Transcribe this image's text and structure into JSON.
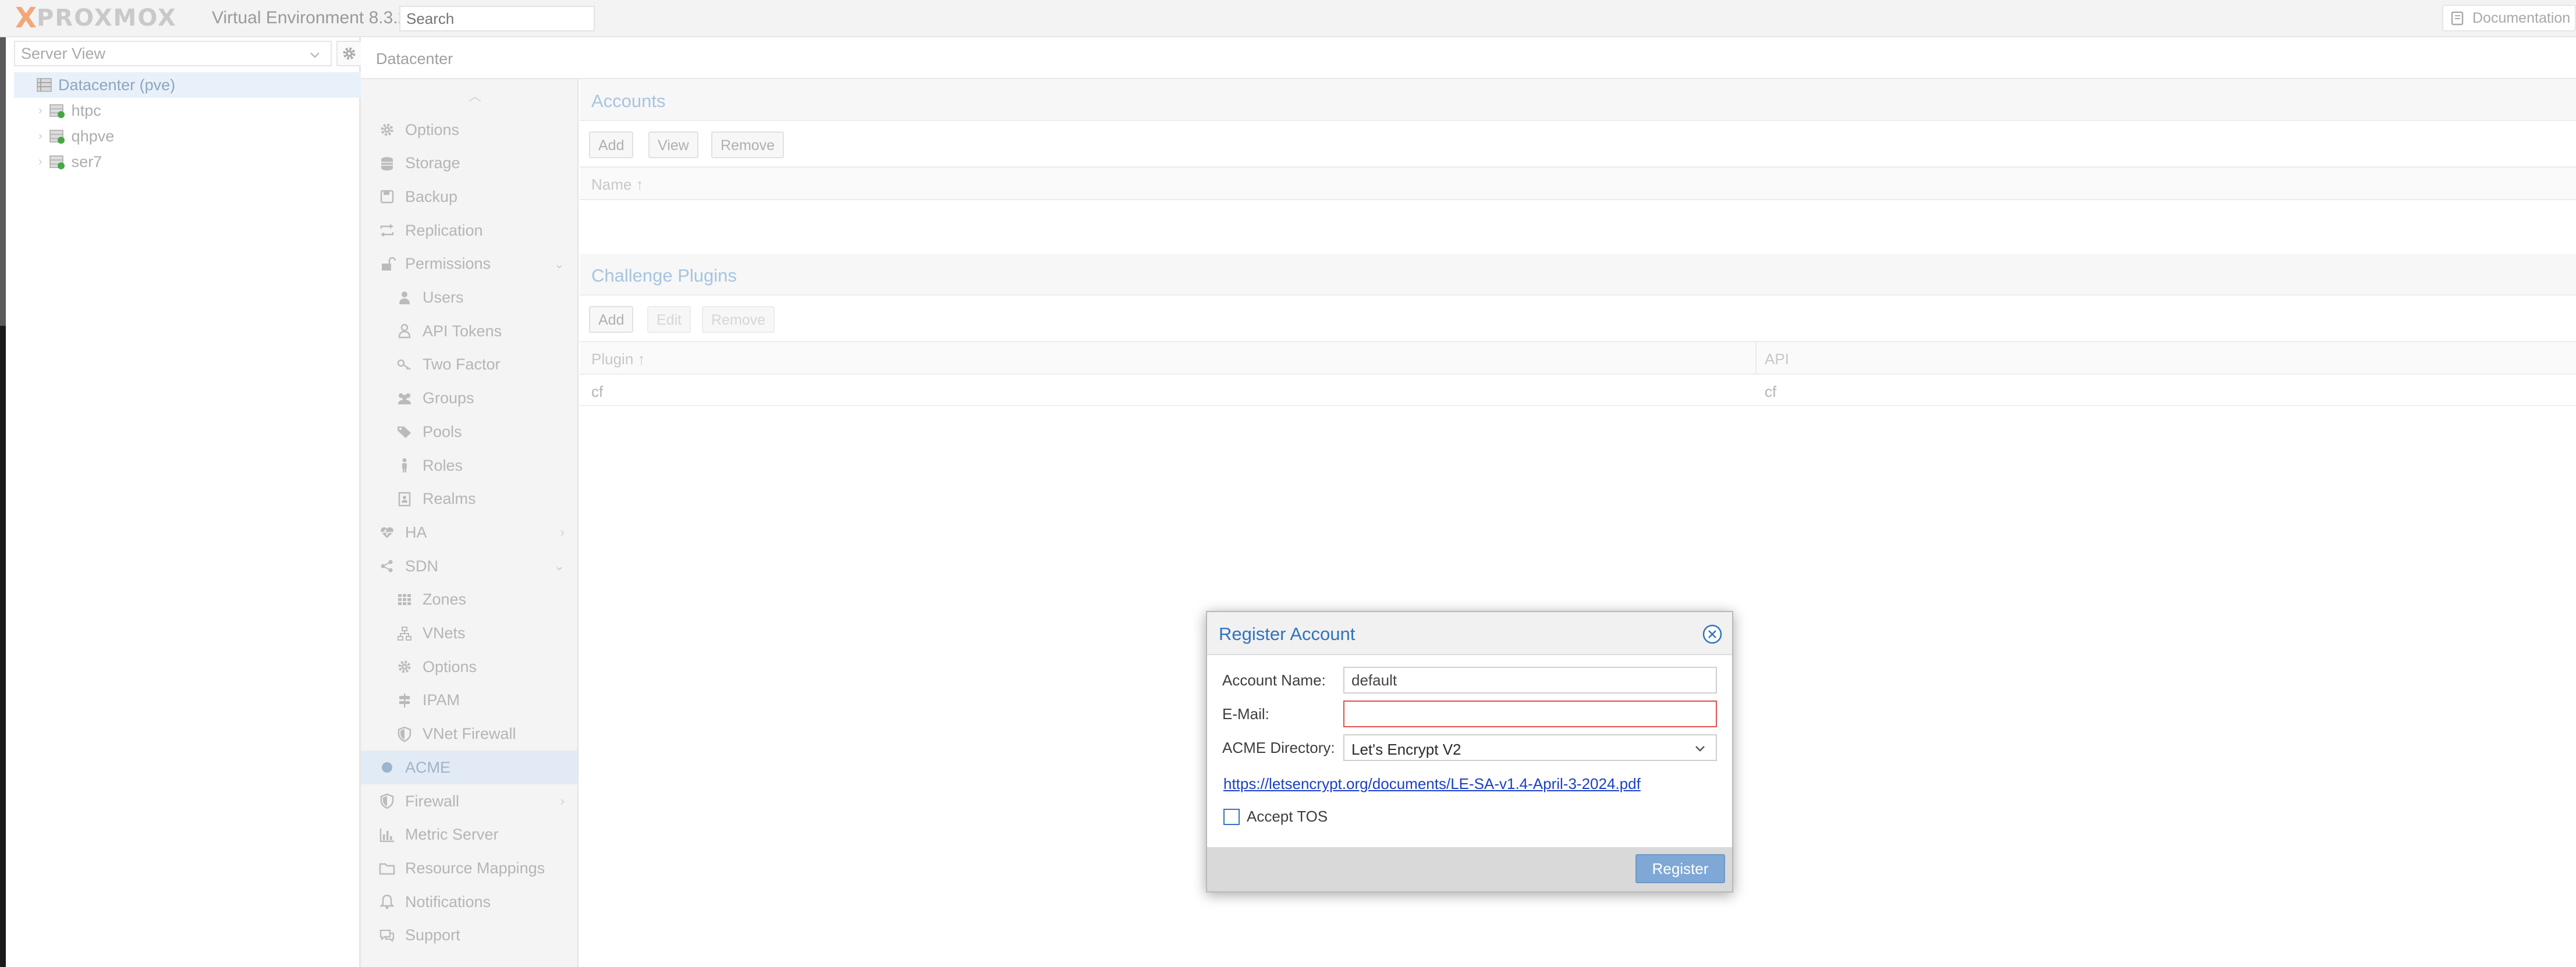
{
  "header": {
    "logo_x1": "X",
    "logo_word": "PROXMOX",
    "version_text": "Virtual Environment 8.3.2",
    "search_placeholder": "Search",
    "documentation_label": "Documentation"
  },
  "sidebar": {
    "view_selector": "Server View",
    "datacenter_label": "Datacenter (pve)",
    "nodes": [
      "htpc",
      "qhpve",
      "ser7"
    ]
  },
  "breadcrumb": "Datacenter",
  "nav": {
    "items": [
      {
        "label": "Options",
        "icon": "gear-icon",
        "level": 0
      },
      {
        "label": "Storage",
        "icon": "database-icon",
        "level": 0
      },
      {
        "label": "Backup",
        "icon": "floppy-icon",
        "level": 0
      },
      {
        "label": "Replication",
        "icon": "retweet-icon",
        "level": 0
      },
      {
        "label": "Permissions",
        "icon": "unlock-icon",
        "level": 0,
        "arrow": "down"
      },
      {
        "label": "Users",
        "icon": "user-icon",
        "level": 1
      },
      {
        "label": "API Tokens",
        "icon": "user-outline-icon",
        "level": 1
      },
      {
        "label": "Two Factor",
        "icon": "key-icon",
        "level": 1
      },
      {
        "label": "Groups",
        "icon": "users-icon",
        "level": 1
      },
      {
        "label": "Pools",
        "icon": "tags-icon",
        "level": 1
      },
      {
        "label": "Roles",
        "icon": "male-icon",
        "level": 1
      },
      {
        "label": "Realms",
        "icon": "address-book-icon",
        "level": 1
      },
      {
        "label": "HA",
        "icon": "heartbeat-icon",
        "level": 0,
        "arrow": "right"
      },
      {
        "label": "SDN",
        "icon": "sdn-icon",
        "level": 0,
        "arrow": "down"
      },
      {
        "label": "Zones",
        "icon": "th-icon",
        "level": 1
      },
      {
        "label": "VNets",
        "icon": "network-icon",
        "level": 1
      },
      {
        "label": "Options",
        "icon": "gear-icon",
        "level": 1
      },
      {
        "label": "IPAM",
        "icon": "signs-icon",
        "level": 1
      },
      {
        "label": "VNet Firewall",
        "icon": "shield-icon",
        "level": 1
      },
      {
        "label": "ACME",
        "icon": "certificate-icon",
        "level": 0,
        "active": true
      },
      {
        "label": "Firewall",
        "icon": "shield-icon",
        "level": 0,
        "arrow": "right"
      },
      {
        "label": "Metric Server",
        "icon": "bar-chart-icon",
        "level": 0
      },
      {
        "label": "Resource Mappings",
        "icon": "folder-icon",
        "level": 0
      },
      {
        "label": "Notifications",
        "icon": "bell-icon",
        "level": 0
      },
      {
        "label": "Support",
        "icon": "comments-icon",
        "level": 0
      }
    ]
  },
  "accounts": {
    "title": "Accounts",
    "buttons": {
      "add": "Add",
      "view": "View",
      "remove": "Remove"
    },
    "columns": [
      "Name ↑"
    ]
  },
  "plugins": {
    "title": "Challenge Plugins",
    "buttons": {
      "add": "Add",
      "edit": "Edit",
      "remove": "Remove"
    },
    "columns": [
      "Plugin ↑",
      "API"
    ],
    "rows": [
      {
        "plugin": "cf",
        "api": "cf"
      }
    ]
  },
  "dialog": {
    "title": "Register Account",
    "account_name_label": "Account Name:",
    "account_name_value": "default",
    "email_label": "E-Mail:",
    "email_value": "",
    "directory_label": "ACME Directory:",
    "directory_value": "Let's Encrypt V2",
    "tos_url": "https://letsencrypt.org/documents/LE-SA-v1.4-April-3-2024.pdf",
    "accept_tos_label": "Accept TOS",
    "accept_tos_checked": false,
    "register_label": "Register"
  },
  "colors": {
    "accent": "#2f73bd",
    "logo_orange": "#f2a77a",
    "invalid_border": "#e05050",
    "register_button": "#7fa8d6"
  }
}
